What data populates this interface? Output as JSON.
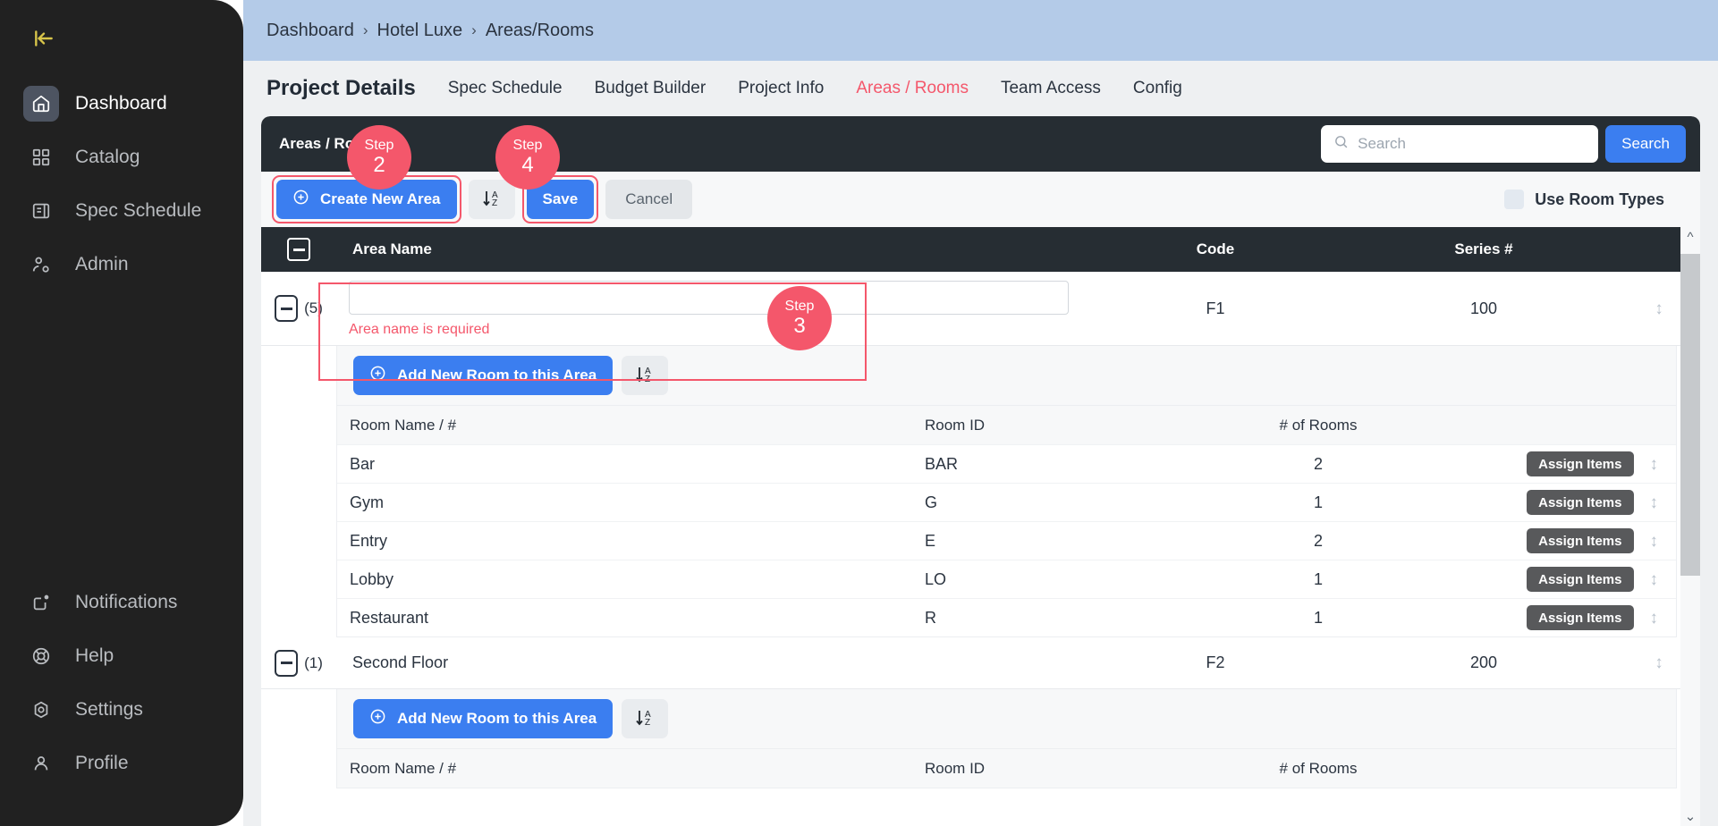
{
  "sidebar": {
    "collapse_icon": "collapse-panel-icon",
    "items": [
      {
        "label": "Dashboard",
        "icon": "home-icon",
        "active": true
      },
      {
        "label": "Catalog",
        "icon": "grid-icon",
        "active": false
      },
      {
        "label": "Spec Schedule",
        "icon": "document-list-icon",
        "active": false
      },
      {
        "label": "Admin",
        "icon": "user-gear-icon",
        "active": false
      }
    ],
    "bottom_items": [
      {
        "label": "Notifications",
        "icon": "notification-icon"
      },
      {
        "label": "Help",
        "icon": "lifebuoy-icon"
      },
      {
        "label": "Settings",
        "icon": "gear-icon"
      },
      {
        "label": "Profile",
        "icon": "user-icon"
      }
    ]
  },
  "breadcrumb": {
    "items": [
      "Dashboard",
      "Hotel Luxe",
      "Areas/Rooms"
    ],
    "separator": "›"
  },
  "tabs": {
    "page_title": "Project Details",
    "items": [
      {
        "label": "Spec Schedule",
        "current": false
      },
      {
        "label": "Budget Builder",
        "current": false
      },
      {
        "label": "Project Info",
        "current": false
      },
      {
        "label": "Areas / Rooms",
        "current": true
      },
      {
        "label": "Team Access",
        "current": false
      },
      {
        "label": "Config",
        "current": false
      }
    ]
  },
  "panel": {
    "title": "Areas / Rooms",
    "search": {
      "placeholder": "Search",
      "value": "",
      "button_label": "Search",
      "icon": "search-icon"
    }
  },
  "toolbar": {
    "create_area_label": "Create New Area",
    "create_area_icon": "plus-circle-icon",
    "sort_icon": "sort-az-icon",
    "save_label": "Save",
    "cancel_label": "Cancel",
    "use_room_types_label": "Use Room Types",
    "use_room_types_checked": false
  },
  "table": {
    "headers": {
      "area_name": "Area Name",
      "code": "Code",
      "series": "Series #"
    },
    "room_headers": {
      "name": "Room Name / #",
      "id": "Room ID",
      "count": "# of Rooms"
    },
    "assign_label": "Assign Items",
    "add_room_label": "Add New Room to this Area",
    "areas": [
      {
        "name": "",
        "name_value": "",
        "error": "Area name is required",
        "count": "(5)",
        "code": "F1",
        "series": "100",
        "rooms": [
          {
            "name": "Bar",
            "id": "BAR",
            "count": "2"
          },
          {
            "name": "Gym",
            "id": "G",
            "count": "1"
          },
          {
            "name": "Entry",
            "id": "E",
            "count": "2"
          },
          {
            "name": "Lobby",
            "id": "LO",
            "count": "1"
          },
          {
            "name": "Restaurant",
            "id": "R",
            "count": "1"
          }
        ]
      },
      {
        "name": "Second Floor",
        "count": "(1)",
        "code": "F2",
        "series": "200",
        "rooms": []
      }
    ]
  },
  "steps": [
    {
      "word": "Step",
      "num": "2"
    },
    {
      "word": "Step",
      "num": "4"
    },
    {
      "word": "Step",
      "num": "3"
    }
  ],
  "colors": {
    "accent_blue": "#3b7ef0",
    "accent_red": "#f4576b",
    "panel_dark": "#262d33",
    "sidebar_dark": "#212121",
    "breadcrumb_blue": "#b4cbe8"
  }
}
